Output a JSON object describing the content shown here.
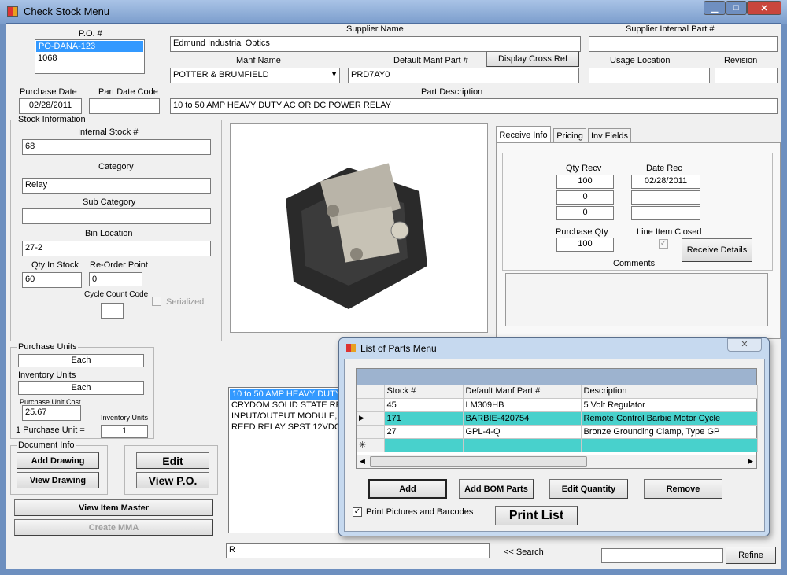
{
  "window": {
    "title": "Check Stock Menu",
    "min": "▁",
    "max": "□",
    "close": "✕"
  },
  "po": {
    "label": "P.O. #",
    "items": [
      "PO-DANA-123",
      "1068"
    ]
  },
  "supplier": {
    "label": "Supplier Name",
    "value": "Edmund Industrial Optics"
  },
  "supplier_part": {
    "label": "Supplier Internal Part #",
    "value": ""
  },
  "manf": {
    "label": "Manf Name",
    "value": "POTTER & BRUMFIELD"
  },
  "manf_part": {
    "label": "Default Manf Part #",
    "value": "PRD7AY0"
  },
  "display_cross_ref": "Display Cross Ref",
  "usage_location": {
    "label": "Usage Location",
    "value": ""
  },
  "revision": {
    "label": "Revision",
    "value": ""
  },
  "purchase_date": {
    "label": "Purchase Date",
    "value": "02/28/2011"
  },
  "part_date_code": {
    "label": "Part Date Code",
    "value": ""
  },
  "part_description": {
    "label": "Part Description",
    "value": "10 to 50 AMP HEAVY DUTY AC OR DC POWER RELAY"
  },
  "stock": {
    "title": "Stock Information",
    "internal_label": "Internal Stock #",
    "internal": "68",
    "category_label": "Category",
    "category": "Relay",
    "subcat_label": "Sub Category",
    "subcat": "",
    "bin_label": "Bin Location",
    "bin": "27-2",
    "qty_label": "Qty In Stock",
    "qty": "60",
    "reorder_label": "Re-Order Point",
    "reorder": "0",
    "cycle_label": "Cycle Count Code",
    "cycle": "",
    "serialized": "Serialized"
  },
  "units": {
    "title": "Purchase Units",
    "purchase": "Each",
    "inv_label": "Inventory Units",
    "inv": "Each",
    "cost_label": "Purchase Unit Cost",
    "cost": "25.67",
    "inv_units_label": "Inventory Units",
    "eq_label": "1 Purchase Unit =",
    "eq": "1"
  },
  "doc": {
    "title": "Document Info",
    "add": "Add Drawing",
    "view": "View Drawing",
    "edit": "Edit",
    "view_po": "View P.O.",
    "item_master": "View Item Master",
    "mma": "Create MMA"
  },
  "tabs": [
    "Receive Info",
    "Pricing",
    "Inv Fields"
  ],
  "receive": {
    "qty_label": "Qty Recv",
    "date_label": "Date Rec",
    "qty": [
      "100",
      "0",
      "0"
    ],
    "dates": [
      "02/28/2011",
      "",
      ""
    ],
    "pq_label": "Purchase Qty",
    "pq": "100",
    "closed_label": "Line Item Closed",
    "details": "Receive Details",
    "comments_label": "Comments"
  },
  "results": [
    "10 to 50 AMP HEAVY DUTY",
    "CRYDOM SOLID STATE REL",
    "INPUT/OUTPUT MODULE, SC",
    "REED RELAY SPST 12VDC F"
  ],
  "search": {
    "value": "R",
    "label": "<< Search",
    "refine_value": "",
    "refine": "Refine"
  },
  "parts_dialog": {
    "title": "List of Parts Menu",
    "columns": [
      "Stock #",
      "Default Manf Part #",
      "Description"
    ],
    "rows": [
      [
        "45",
        "LM309HB",
        "5 Volt Regulator"
      ],
      [
        "171",
        "BARBIE-420754",
        "Remote Control Barbie Motor Cycle"
      ],
      [
        "27",
        "GPL-4-Q",
        "Bronze Grounding Clamp, Type GP"
      ]
    ],
    "add": "Add",
    "bom": "Add BOM Parts",
    "edit_qty": "Edit Quantity",
    "remove": "Remove",
    "print_check": "Print Pictures and Barcodes",
    "print": "Print List",
    "selected_color": "#48d1cc"
  }
}
